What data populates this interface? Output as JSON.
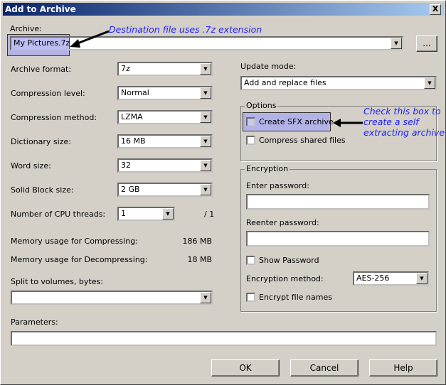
{
  "window": {
    "title": "Add to Archive",
    "close": "X"
  },
  "archive": {
    "label": "Archive:",
    "value": "My Pictures.7z",
    "browse": "..."
  },
  "left": {
    "rows": [
      {
        "label": "Archive format:",
        "value": "7z"
      },
      {
        "label": "Compression level:",
        "value": "Normal"
      },
      {
        "label": "Compression method:",
        "value": "LZMA"
      },
      {
        "label": "Dictionary size:",
        "value": "16 MB"
      },
      {
        "label": "Word size:",
        "value": "32"
      },
      {
        "label": "Solid Block size:",
        "value": "2 GB"
      }
    ],
    "cpu": {
      "label": "Number of CPU threads:",
      "value": "1",
      "max": "/ 1"
    },
    "mem_comp": {
      "label": "Memory usage for Compressing:",
      "value": "186 MB"
    },
    "mem_decomp": {
      "label": "Memory usage for Decompressing:",
      "value": "18 MB"
    },
    "split": {
      "label": "Split to volumes, bytes:",
      "value": ""
    }
  },
  "parameters": {
    "label": "Parameters:",
    "value": ""
  },
  "update": {
    "label": "Update mode:",
    "value": "Add and replace files"
  },
  "options": {
    "title": "Options",
    "sfx": "Create SFX archive",
    "shared": "Compress shared files"
  },
  "encryption": {
    "title": "Encryption",
    "enter": "Enter password:",
    "reenter": "Reenter password:",
    "show": "Show Password",
    "method_label": "Encryption method:",
    "method": "AES-256",
    "encrypt_names": "Encrypt file names"
  },
  "buttons": {
    "ok": "OK",
    "cancel": "Cancel",
    "help": "Help"
  },
  "annotations": {
    "dest": "Destination file uses .7z extension",
    "sfx": "Check this box to create a self extracting archive"
  },
  "colors": {
    "annotation": "#2020ff",
    "highlight": "#a8a8f0"
  }
}
